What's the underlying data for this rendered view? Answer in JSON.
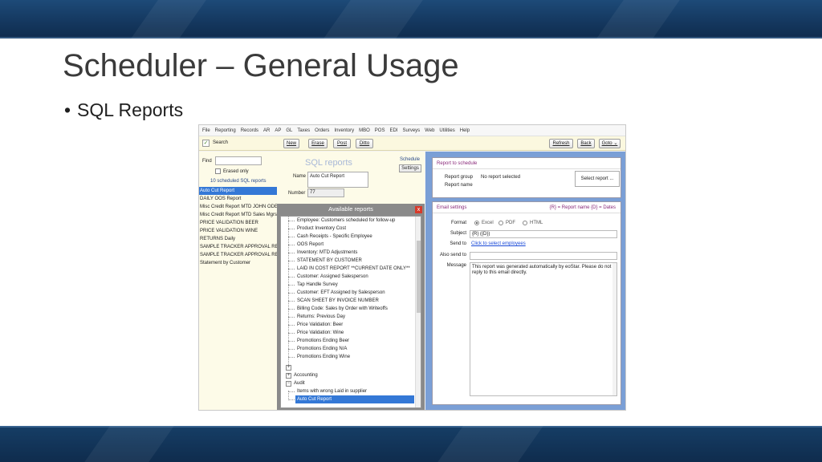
{
  "slide": {
    "title": "Scheduler – General Usage",
    "bullet": "SQL Reports"
  },
  "app": {
    "menu": [
      "File",
      "Reporting",
      "Records",
      "AR",
      "AP",
      "GL",
      "Taxes",
      "Orders",
      "Inventory",
      "MBO",
      "POS",
      "EDI",
      "Surveys",
      "Web",
      "Utilities",
      "Help"
    ],
    "toolbar": {
      "search": "Search",
      "new": "New",
      "erase": "Erase",
      "post": "Post",
      "ditto": "Ditto",
      "refresh": "Refresh",
      "back": "Back",
      "goto": "Goto ⌄"
    },
    "left": {
      "find_label": "Find",
      "erased_only": "Erased only",
      "scheduled_count": "10 scheduled SQL reports",
      "reports": [
        "Auto Cut Report",
        "DAILY OOS Report",
        "Misc Credit Report MTD JOHN ODE...",
        "Misc Credit Report MTD Sales Mgrs",
        "PRICE VALIDATION BEER",
        "PRICE VALIDATION WINE",
        "RETURNS Daily",
        "SAMPLE TRACKER APPROVAL REQ...",
        "SAMPLE TRACKER APPROVAL REQ...",
        "Statement by Customer"
      ],
      "selected_index": 0
    },
    "middle": {
      "title": "SQL reports",
      "name_label": "Name",
      "name_value": "Auto Cut Report",
      "number_label": "Number",
      "number_value": "77",
      "schedule_label": "Schedule",
      "settings_label": "Settings"
    },
    "popup": {
      "title": "Available reports",
      "close": "x",
      "items": [
        "Employee: Customers scheduled for follow-up",
        "Product Inventory Cost",
        "Cash Receipts - Specific Employee",
        "OOS Report",
        "Inventory: MTD Adjustments",
        "STATEMENT BY CUSTOMER",
        "LAID IN COST REPORT **CURRENT DATE ONLY**",
        "Customer: Assigned Salesperson",
        "Tap Handle Survey",
        "Customer: EFT Assigned by Salesperson",
        "SCAN SHEET BY INVOICE NUMBER",
        "Billing Code: Sales by Order with Writeoffs",
        "Returns: Previous Day",
        "Price Validation: Beer",
        "Price Validation: Wine",
        "Promotions Ending Beer",
        "Promotions Ending N/A",
        "Promotions Ending Wine"
      ],
      "groups": [
        "Accounting",
        "Audit"
      ],
      "audit_items": [
        "Items with wrong Laid in supplier",
        "Auto Cut Report"
      ],
      "selected": "Auto Cut Report"
    },
    "right": {
      "report_box_title": "Report to schedule",
      "report_group_label": "Report group",
      "report_group_value": "No report selected",
      "report_name_label": "Report name",
      "select_report": "Select report ...",
      "email_title": "Email settings",
      "email_hint": "{R} = Report name    {D} = Dates",
      "format_label": "Format",
      "formats": [
        "Excel",
        "PDF",
        "HTML"
      ],
      "selected_format": "Excel",
      "subject_label": "Subject",
      "subject_value": "{R} ({D})",
      "send_to_label": "Send to",
      "send_to_link": "Click to select employees",
      "also_send_label": "Also send to",
      "message_label": "Message",
      "message_value": "This report was generated automatically by eoStar.  Please do not reply to this email directly."
    }
  }
}
